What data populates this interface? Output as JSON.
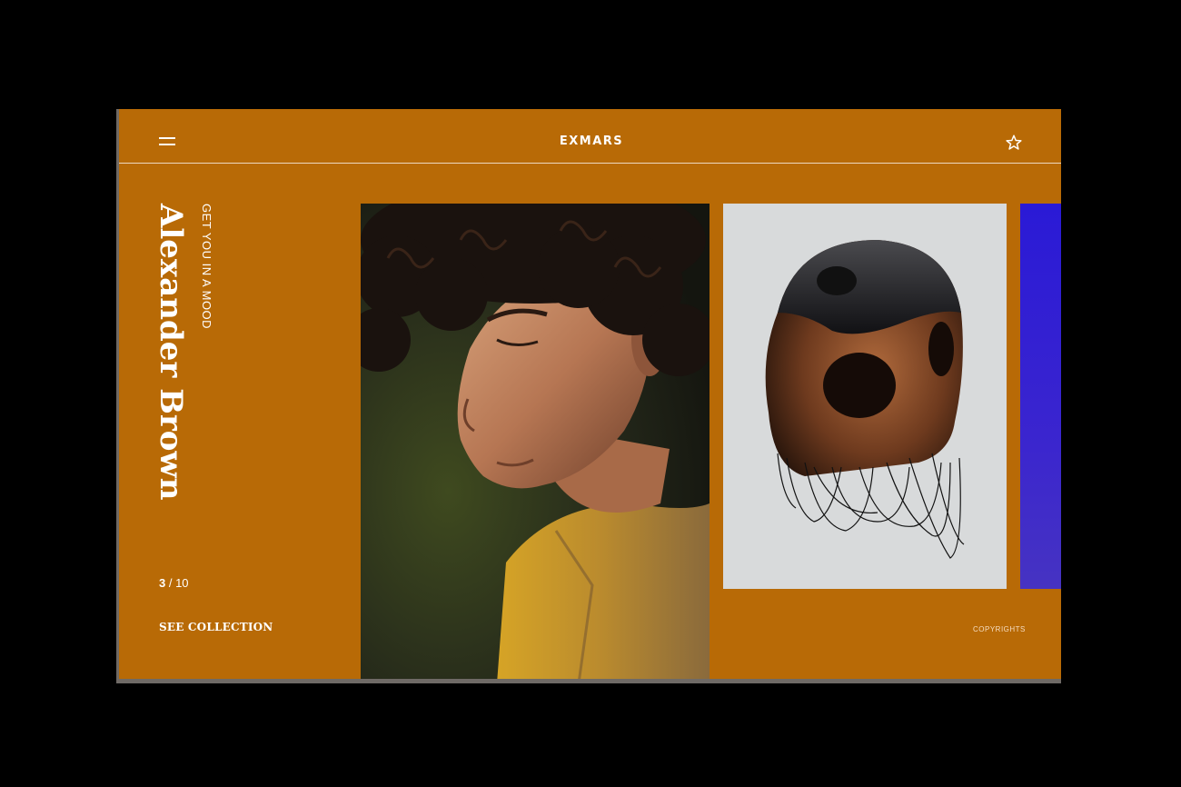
{
  "header": {
    "brand": "EXMARS",
    "menu_icon": "hamburger-menu-icon",
    "favorite_icon": "star-outline-icon"
  },
  "hero": {
    "title": "Alexander Brown",
    "subtitle": "GET YOU IN A MOOD"
  },
  "pager": {
    "current": "3",
    "separator": " / ",
    "total": "10"
  },
  "footer": {
    "cta_label": "SEE COLLECTION",
    "copyrights": "COPYRIGHTS"
  },
  "gallery": {
    "slides": [
      {
        "kind": "portrait-photo"
      },
      {
        "kind": "skull-sculpture-photo"
      },
      {
        "kind": "blue-panel"
      }
    ]
  },
  "colors": {
    "background": "#000000",
    "panel": "#b86a06",
    "text": "#ffffff",
    "skull_card": "#d8dadb",
    "blue_panel": "#2a1ad6"
  }
}
